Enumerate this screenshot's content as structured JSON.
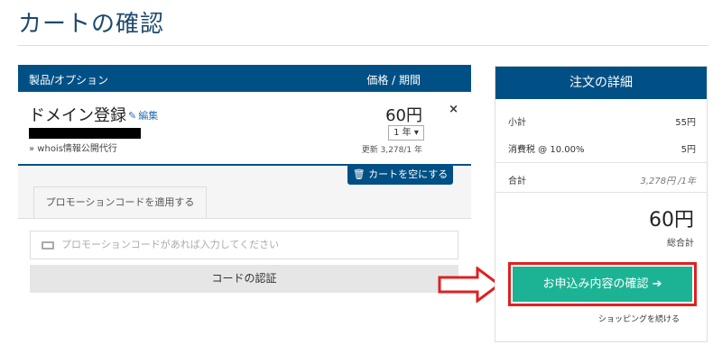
{
  "page": {
    "title": "カートの確認"
  },
  "cart": {
    "header": {
      "product_label": "製品/オプション",
      "price_label": "価格 / 期間"
    },
    "item": {
      "name": "ドメイン登録",
      "edit_label": "編集",
      "addon": "» whois情報公開代行",
      "price": "60円",
      "period": "1 年",
      "renewal": "更新 3,278/1 年",
      "remove_icon": "×"
    },
    "empty_button": "カートを空にする"
  },
  "promo": {
    "tab_label": "プロモーションコードを適用する",
    "placeholder": "プロモーションコードがあれば入力してください",
    "verify_button": "コードの認証"
  },
  "summary": {
    "title": "注文の詳細",
    "subtotal_label": "小計",
    "subtotal_value": "55円",
    "tax_label": "消費税 @ 10.00%",
    "tax_value": "5円",
    "total_row_label": "合計",
    "recurring": "3,278円 /1年",
    "total_amount": "60円",
    "total_label": "総合計",
    "checkout_button": "お申込み内容の確認 ➔",
    "continue_link": "ショッピングを続ける"
  },
  "colors": {
    "header": "#005085",
    "checkout": "#1cb394",
    "highlight": "#e02020"
  }
}
